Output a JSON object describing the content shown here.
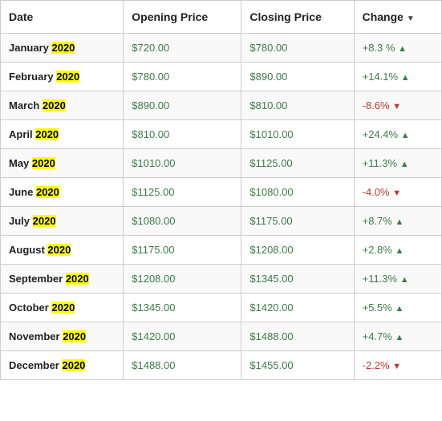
{
  "table": {
    "headers": [
      {
        "label": "Date",
        "key": "date"
      },
      {
        "label": "Opening Price",
        "key": "opening"
      },
      {
        "label": "Closing Price",
        "key": "closing"
      },
      {
        "label": "Change",
        "key": "change",
        "sortable": true
      }
    ],
    "rows": [
      {
        "month": "January",
        "year": "2020",
        "opening": "$720.00",
        "closing": "$780.00",
        "change": "+8.3 %",
        "positive": true
      },
      {
        "month": "February",
        "year": "2020",
        "opening": "$780.00",
        "closing": "$890.00",
        "change": "+14.1%",
        "positive": true
      },
      {
        "month": "March",
        "year": "2020",
        "opening": "$890.00",
        "closing": "$810.00",
        "change": "-8.6%",
        "positive": false
      },
      {
        "month": "April",
        "year": "2020",
        "opening": "$810.00",
        "closing": "$1010.00",
        "change": "+24.4%",
        "positive": true
      },
      {
        "month": "May",
        "year": "2020",
        "opening": "$1010.00",
        "closing": "$1125.00",
        "change": "+11.3%",
        "positive": true
      },
      {
        "month": "June",
        "year": "2020",
        "opening": "$1125.00",
        "closing": "$1080.00",
        "change": "-4.0%",
        "positive": false
      },
      {
        "month": "July",
        "year": "2020",
        "opening": "$1080.00",
        "closing": "$1175.00",
        "change": "+8.7%",
        "positive": true
      },
      {
        "month": "August",
        "year": "2020",
        "opening": "$1175.00",
        "closing": "$1208.00",
        "change": "+2.8%",
        "positive": true
      },
      {
        "month": "September",
        "year": "2020",
        "opening": "$1208.00",
        "closing": "$1345.00",
        "change": "+11.3%",
        "positive": true
      },
      {
        "month": "October",
        "year": "2020",
        "opening": "$1345.00",
        "closing": "$1420.00",
        "change": "+5.5%",
        "positive": true
      },
      {
        "month": "November",
        "year": "2020",
        "opening": "$1420.00",
        "closing": "$1488.00",
        "change": "+4.7%",
        "positive": true
      },
      {
        "month": "December",
        "year": "2020",
        "opening": "$1488.00",
        "closing": "$1455.00",
        "change": "-2.2%",
        "positive": false
      }
    ]
  }
}
